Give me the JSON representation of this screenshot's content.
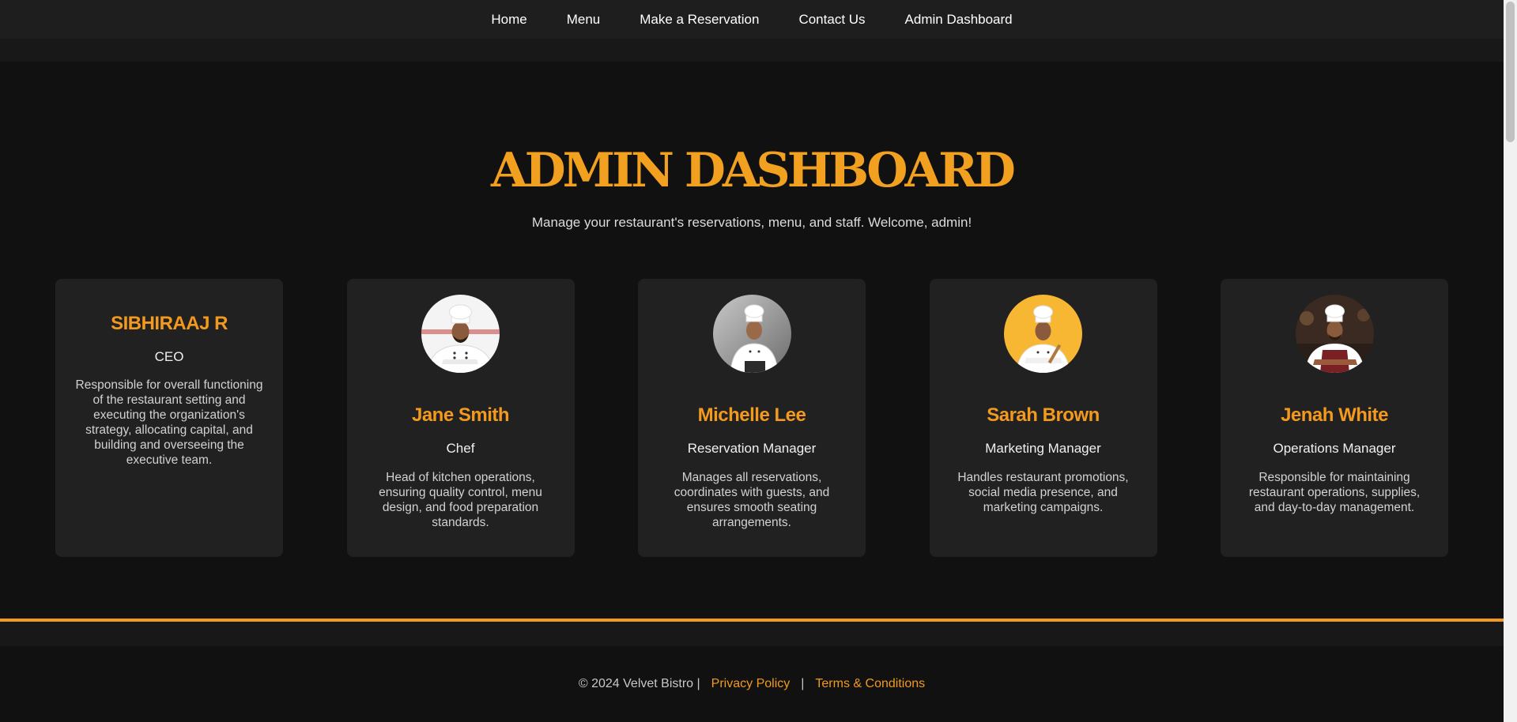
{
  "nav": {
    "items": [
      {
        "label": "Home"
      },
      {
        "label": "Menu"
      },
      {
        "label": "Make a Reservation"
      },
      {
        "label": "Contact Us"
      },
      {
        "label": "Admin Dashboard"
      }
    ]
  },
  "hero": {
    "title": "ADMIN DASHBOARD",
    "subtitle": "Manage your restaurant's reservations, menu, and staff. Welcome, admin!"
  },
  "staff": [
    {
      "name": "SIBHIRAAJ R",
      "role": "CEO",
      "description": "Responsible for overall functioning of the restaurant setting and executing the organization's strategy, allocating capital, and building and overseeing the executive team."
    },
    {
      "name": "Jane Smith",
      "role": "Chef",
      "description": "Head of kitchen operations, ensuring quality control, menu design, and food preparation standards.",
      "photo": "chef-portrait-white-background"
    },
    {
      "name": "Michelle Lee",
      "role": "Reservation Manager",
      "description": "Manages all reservations, coordinates with guests, and ensures smooth seating arrangements.",
      "photo": "chef-portrait-grey-background"
    },
    {
      "name": "Sarah Brown",
      "role": "Marketing Manager",
      "description": "Handles restaurant promotions, social media presence, and marketing campaigns.",
      "photo": "chef-portrait-yellow-background"
    },
    {
      "name": "Jenah White",
      "role": "Operations Manager",
      "description": "Responsible for maintaining restaurant operations, supplies, and day-to-day management.",
      "photo": "chef-portrait-kitchen-background"
    }
  ],
  "footer": {
    "copyright": "© 2024 Velvet Bistro |",
    "separator": "|",
    "privacy": "Privacy Policy",
    "terms": "Terms & Conditions"
  },
  "colors": {
    "accent": "#f39a1e",
    "background": "#111111",
    "card": "#212121",
    "nav": "#1e1e1e"
  }
}
